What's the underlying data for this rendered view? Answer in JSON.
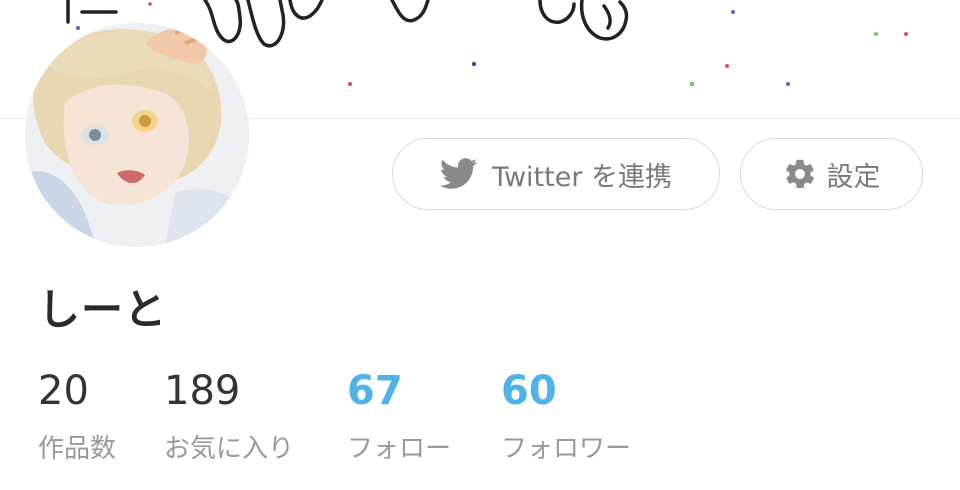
{
  "header": {
    "banner": "hand-drawn banner with confetti dots"
  },
  "profile": {
    "avatar": "anime-style illustrated avatar",
    "username": "しーと"
  },
  "actions": {
    "twitter_label": "Twitter を連携",
    "twitter_icon": "twitter-bird-icon",
    "settings_label": "設定",
    "settings_icon": "gear-icon"
  },
  "stats": {
    "works": {
      "value": "20",
      "label": "作品数"
    },
    "favorites": {
      "value": "189",
      "label": "お気に入り"
    },
    "following": {
      "value": "67",
      "label": "フォロー"
    },
    "followers": {
      "value": "60",
      "label": "フォロワー"
    }
  },
  "colors": {
    "accent": "#4fb3e8",
    "text": "#333333",
    "muted": "#9a9a9a",
    "border": "#dcdcdc"
  }
}
